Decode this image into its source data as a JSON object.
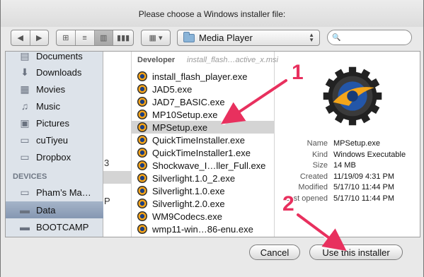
{
  "dialog": {
    "title": "Please choose a Windows installer file:"
  },
  "toolbar": {
    "back_icon": "chevron-left-icon",
    "forward_icon": "chevron-right-icon",
    "view_icon_label": "⊞",
    "view_list_label": "≡",
    "view_column_label": "▥",
    "view_coverflow_label": "▮▮▮",
    "arrange_label": "▦ ▾",
    "location": "Media Player",
    "search_placeholder": "🔍"
  },
  "sidebar": {
    "items": [
      {
        "label": "Documents",
        "icon": "documents-icon",
        "glyph": "▤"
      },
      {
        "label": "Downloads",
        "icon": "downloads-icon",
        "glyph": "⬇"
      },
      {
        "label": "Movies",
        "icon": "movies-icon",
        "glyph": "▦"
      },
      {
        "label": "Music",
        "icon": "music-icon",
        "glyph": "♫"
      },
      {
        "label": "Pictures",
        "icon": "pictures-icon",
        "glyph": "▣"
      },
      {
        "label": "cuTiyeu",
        "icon": "folder-icon",
        "glyph": "▭"
      },
      {
        "label": "Dropbox",
        "icon": "dropbox-icon",
        "glyph": "▭"
      }
    ],
    "devices_heading": "DEVICES",
    "devices": [
      {
        "label": "Pham’s Ma…",
        "icon": "computer-icon",
        "glyph": "▭"
      },
      {
        "label": "Data",
        "icon": "disk-icon",
        "glyph": "▬"
      },
      {
        "label": "BOOTCAMP",
        "icon": "disk-icon",
        "glyph": "▬"
      }
    ]
  },
  "column1": {
    "fragments": [
      "3",
      "P"
    ]
  },
  "column2": {
    "header": "Developer",
    "ghost_drag": "install_flash…active_x.msi",
    "files": [
      "install_flash_player.exe",
      "JAD5.exe",
      "JAD7_BASIC.exe",
      "MP10Setup.exe",
      "MPSetup.exe",
      "QuickTimeInstaller.exe",
      "QuickTimeInstaller1.exe",
      "Shockwave_I…ller_Full.exe",
      "Silverlight.1.0_2.exe",
      "Silverlight.1.0.exe",
      "Silverlight.2.0.exe",
      "WM9Codecs.exe",
      "wmp11-win…86-enu.exe"
    ],
    "selected_file": "MPSetup.exe"
  },
  "preview": {
    "rows": [
      {
        "key": "Name",
        "value": "MPSetup.exe"
      },
      {
        "key": "Kind",
        "value": "Windows Executable"
      },
      {
        "key": "Size",
        "value": "14 MB"
      },
      {
        "key": "Created",
        "value": "11/19/09 4:31 PM"
      },
      {
        "key": "Modified",
        "value": "5/17/10 11:44 PM"
      },
      {
        "key": "Last opened",
        "value": "5/17/10 11:44 PM"
      }
    ]
  },
  "footer": {
    "cancel_label": "Cancel",
    "confirm_label": "Use this installer"
  },
  "annotations": {
    "marker1": "1",
    "marker2": "2",
    "color": "#e8305e"
  }
}
